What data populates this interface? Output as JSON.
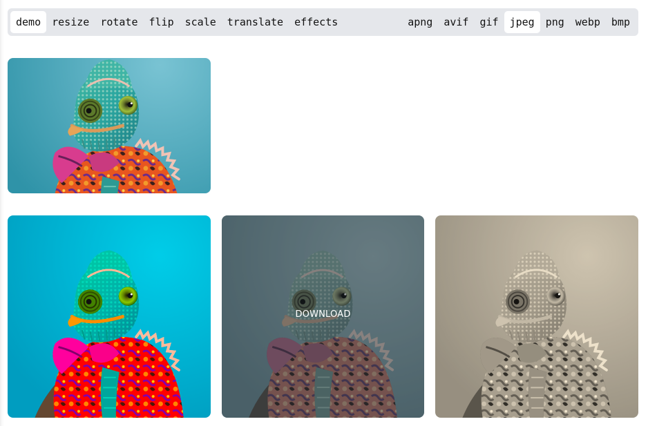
{
  "toolbar": {
    "operations": [
      {
        "label": "demo",
        "active": true
      },
      {
        "label": "resize",
        "active": false
      },
      {
        "label": "rotate",
        "active": false
      },
      {
        "label": "flip",
        "active": false
      },
      {
        "label": "scale",
        "active": false
      },
      {
        "label": "translate",
        "active": false
      },
      {
        "label": "effects",
        "active": false
      }
    ],
    "formats": [
      {
        "label": "apng",
        "active": false
      },
      {
        "label": "avif",
        "active": false
      },
      {
        "label": "gif",
        "active": false
      },
      {
        "label": "jpeg",
        "active": true
      },
      {
        "label": "png",
        "active": false
      },
      {
        "label": "webp",
        "active": false
      },
      {
        "label": "bmp",
        "active": false
      }
    ]
  },
  "images": {
    "original": {
      "subject": "chameleon"
    },
    "results": [
      {
        "subject": "chameleon",
        "style": "saturated"
      },
      {
        "subject": "chameleon",
        "style": "desaturated",
        "hover_label": "DOWNLOAD"
      },
      {
        "subject": "chameleon",
        "style": "sepia"
      }
    ]
  }
}
